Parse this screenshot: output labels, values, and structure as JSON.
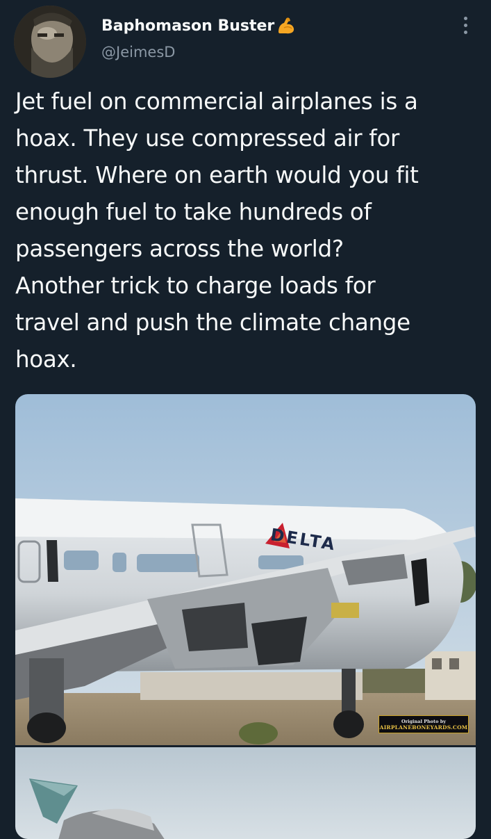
{
  "author": {
    "display_name": "Baphomason Buster",
    "badge_icon": "flexed-biceps-emoji",
    "handle": "@JeimesD"
  },
  "menu": {
    "icon": "more-vertical-icon"
  },
  "tweet": {
    "text": "Jet fuel on commercial airplanes is a\nhoax. They use compressed air for\nthrust. Where on earth would you fit\nenough fuel to take hundreds of\npassengers across the world?\nAnother trick to charge loads for\ntravel and push the climate change\nhoax."
  },
  "media": {
    "photo_1": {
      "airline_logo_text": "DELTA",
      "watermark_line1": "Original Photo by",
      "watermark_line2": "AIRPLANEBONEYARDS.COM"
    }
  },
  "colors": {
    "background": "#15202b",
    "text_primary": "#f7f9f9",
    "text_secondary": "#8b98a5"
  }
}
